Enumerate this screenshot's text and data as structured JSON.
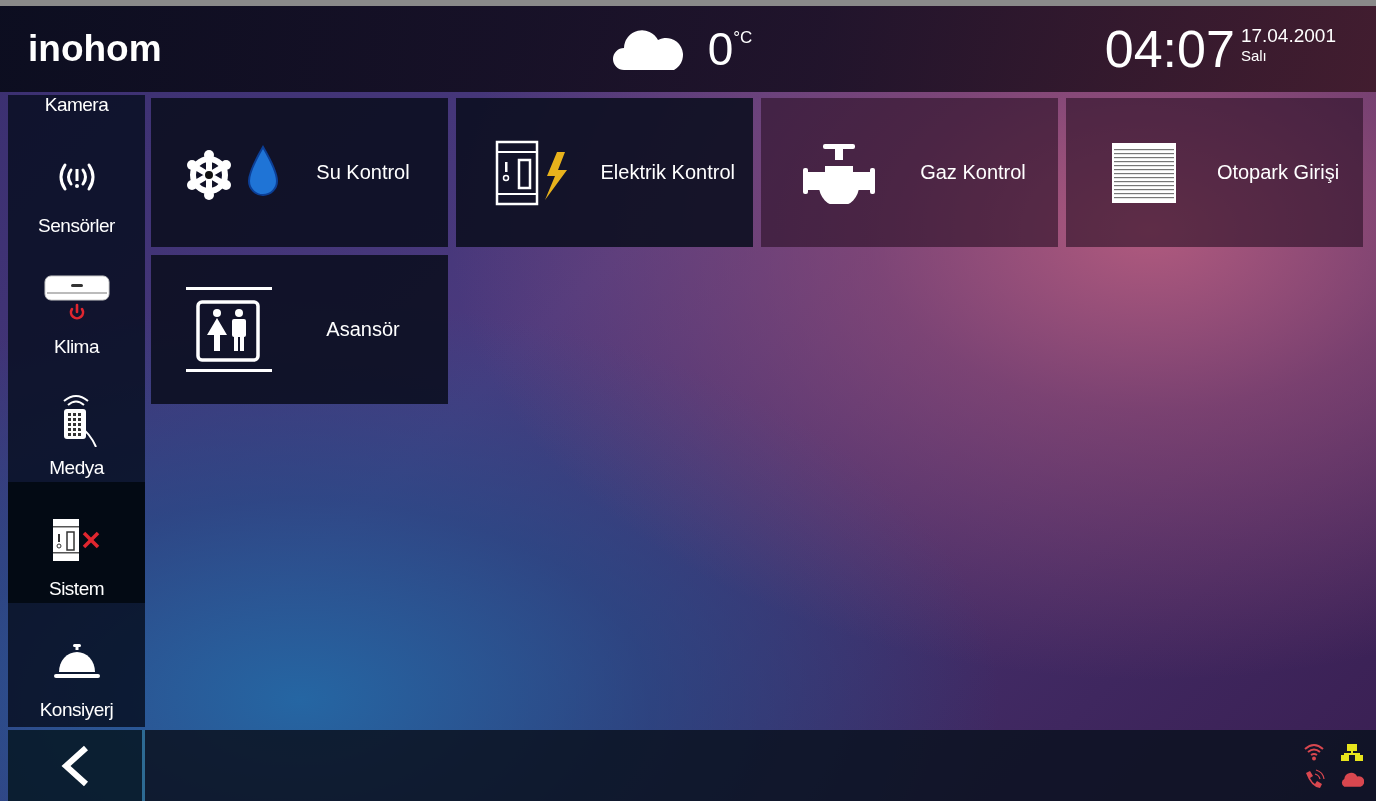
{
  "header": {
    "logo": "inohom",
    "weather": {
      "temperature": "0",
      "unit": "°C"
    },
    "clock": {
      "time": "04:07",
      "date": "17.04.2001",
      "day": "Salı"
    }
  },
  "sidebar": {
    "items": [
      {
        "kind": "camera",
        "label": "Kamera",
        "selected": false
      },
      {
        "kind": "sensor",
        "label": "Sensörler",
        "selected": false
      },
      {
        "kind": "aircon",
        "label": "Klima",
        "selected": false
      },
      {
        "kind": "remote",
        "label": "Medya",
        "selected": false
      },
      {
        "kind": "breaker",
        "label": "Sistem",
        "selected": true
      },
      {
        "kind": "bell",
        "label": "Konsiyerj",
        "selected": false
      }
    ]
  },
  "tiles": [
    {
      "kind": "water",
      "label": "Su Kontrol"
    },
    {
      "kind": "electric",
      "label": "Elektrik Kontrol"
    },
    {
      "kind": "gas",
      "label": "Gaz Kontrol"
    },
    {
      "kind": "shutter",
      "label": "Otopark Girişi"
    },
    {
      "kind": "elevator",
      "label": "Asansör"
    }
  ],
  "status_icons": [
    {
      "kind": "wifi",
      "color": "#d9474f"
    },
    {
      "kind": "network",
      "color": "#e8e41c"
    },
    {
      "kind": "phone",
      "color": "#d9474f"
    },
    {
      "kind": "cloud",
      "color": "#d9474f"
    }
  ]
}
